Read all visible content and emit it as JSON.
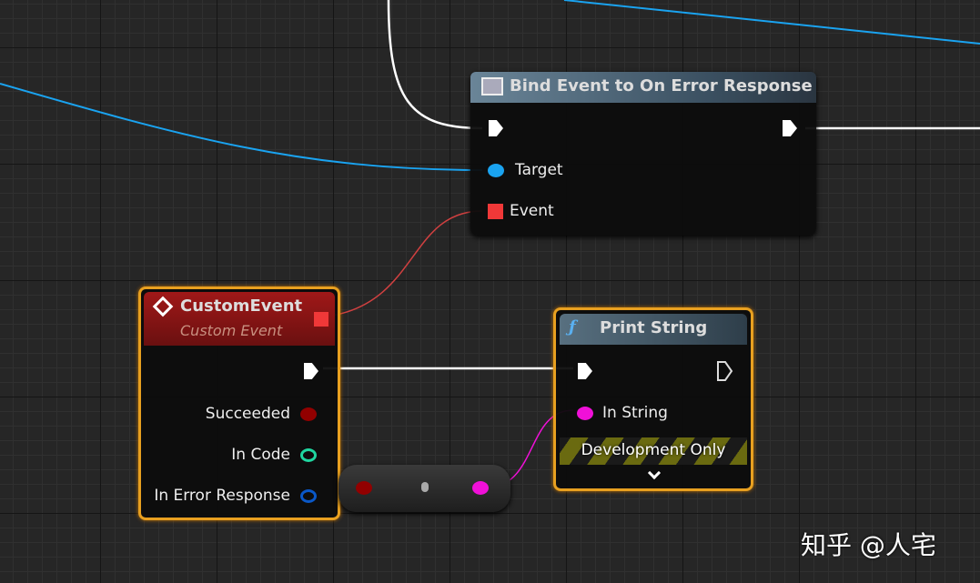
{
  "bind_node": {
    "title": "Bind Event to On Error Response",
    "pins": {
      "target": "Target",
      "event": "Event"
    },
    "icon": "window-icon"
  },
  "custom_event": {
    "title": "CustomEvent",
    "subtitle": "Custom Event",
    "pins": {
      "succeeded": "Succeeded",
      "in_code": "In Code",
      "in_error_response": "In Error Response"
    },
    "icon": "event-diamond-icon"
  },
  "print_string": {
    "title": "Print String",
    "function_glyph": "ƒ",
    "pins": {
      "in_string": "In String"
    },
    "banner": "Development Only",
    "icon": "function-icon"
  },
  "watermark": "知乎 @人宅",
  "colors": {
    "exec": "#ffffff",
    "object": "#1aa3f0",
    "delegate": "#f03838",
    "bool": "#920000",
    "int": "#1fd6a0",
    "struct": "#0a58c8",
    "string": "#f010d8",
    "selected": "#e8a020"
  }
}
